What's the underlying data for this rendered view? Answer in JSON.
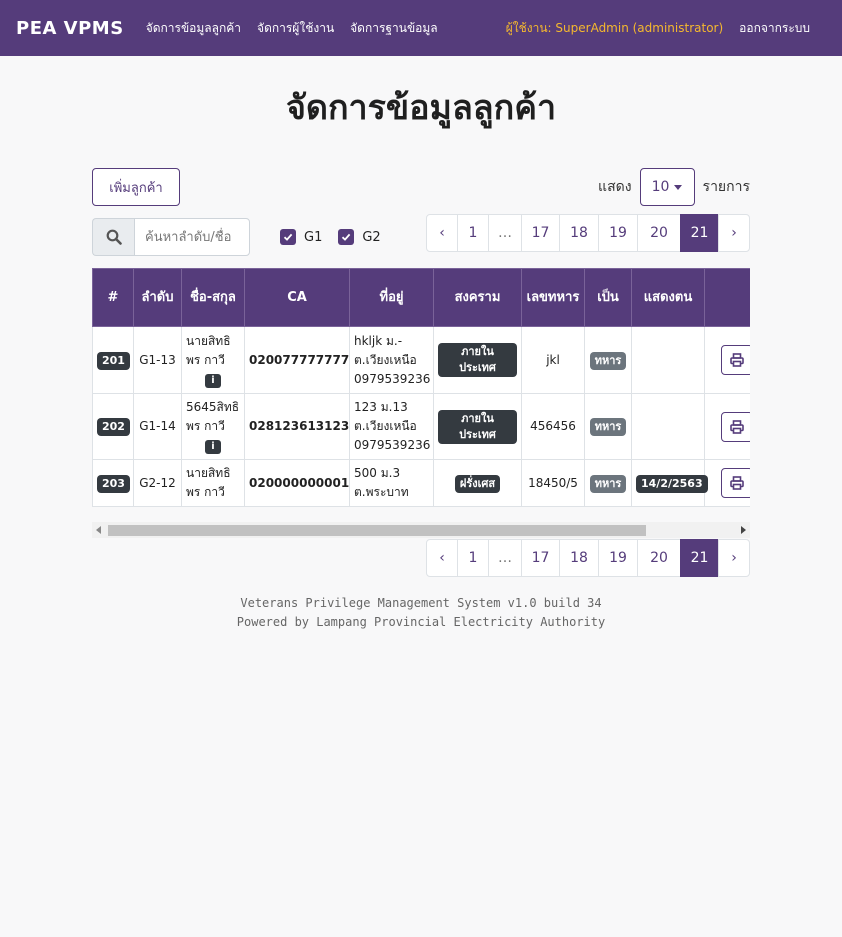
{
  "navbar": {
    "brand": "PEA VPMS",
    "links": [
      "จัดการข้อมูลลูกค้า",
      "จัดการผู้ใช้งาน",
      "จัดการฐานข้อมูล"
    ],
    "user": "ผู้ใช้งาน: SuperAdmin (administrator)",
    "logout": "ออกจากระบบ"
  },
  "page": {
    "title": "จัดการข้อมูลลูกค้า"
  },
  "toolbar": {
    "add_label": "เพิ่มลูกค้า",
    "show_label": "แสดง",
    "page_size": "10",
    "items_label": "รายการ"
  },
  "search": {
    "placeholder": "ค้นหาลำดับ/ชื่อ"
  },
  "filters": [
    "G1",
    "G2"
  ],
  "pagination": [
    "‹",
    "1",
    "…",
    "17",
    "18",
    "19",
    "20",
    "21",
    "›"
  ],
  "pagination_active": "21",
  "table": {
    "headers": [
      "#",
      "ลำดับ",
      "ชื่อ-สกุล",
      "CA",
      "ที่อยู่",
      "สงคราม",
      "เลขทหาร",
      "เป็น",
      "แสดงตน",
      ""
    ],
    "rows": [
      {
        "id": "201",
        "order": "G1-13",
        "name": "นายสิทธิพร กาวี",
        "has_info": true,
        "ca": "020077777777",
        "address": "hkljk ม.- ต.เวียงเหนือ 0979539236",
        "war": "ภายในประเทศ",
        "soldier_no": "jkl",
        "type": "ทหาร",
        "date": ""
      },
      {
        "id": "202",
        "order": "G1-14",
        "name": "5645สิทธิพร กาวี",
        "has_info": true,
        "ca": "028123613123",
        "address": "123 ม.13 ต.เวียงเหนือ 0979539236",
        "war": "ภายในประเทศ",
        "soldier_no": "456456",
        "type": "ทหาร",
        "date": ""
      },
      {
        "id": "203",
        "order": "G2-12",
        "name": "นายสิทธิพร กาวี",
        "has_info": false,
        "ca": "020000000001",
        "address": "500 ม.3 ต.พระบาท",
        "war": "ฝรั่งเศส",
        "soldier_no": "18450/5",
        "type": "ทหาร",
        "date": "14/2/2563"
      }
    ]
  },
  "footer": {
    "line1": "Veterans Privilege Management System v1.0 build 34",
    "line2": "Powered by Lampang Provincial Electricity Authority"
  },
  "colors": {
    "primary": "#553c7b",
    "user_accent": "#f5b82e",
    "badge_dark": "#343a40",
    "badge_gray": "#6c757d"
  },
  "icons": {
    "search": "search-icon",
    "print": "print-icon",
    "info": "info-icon"
  }
}
